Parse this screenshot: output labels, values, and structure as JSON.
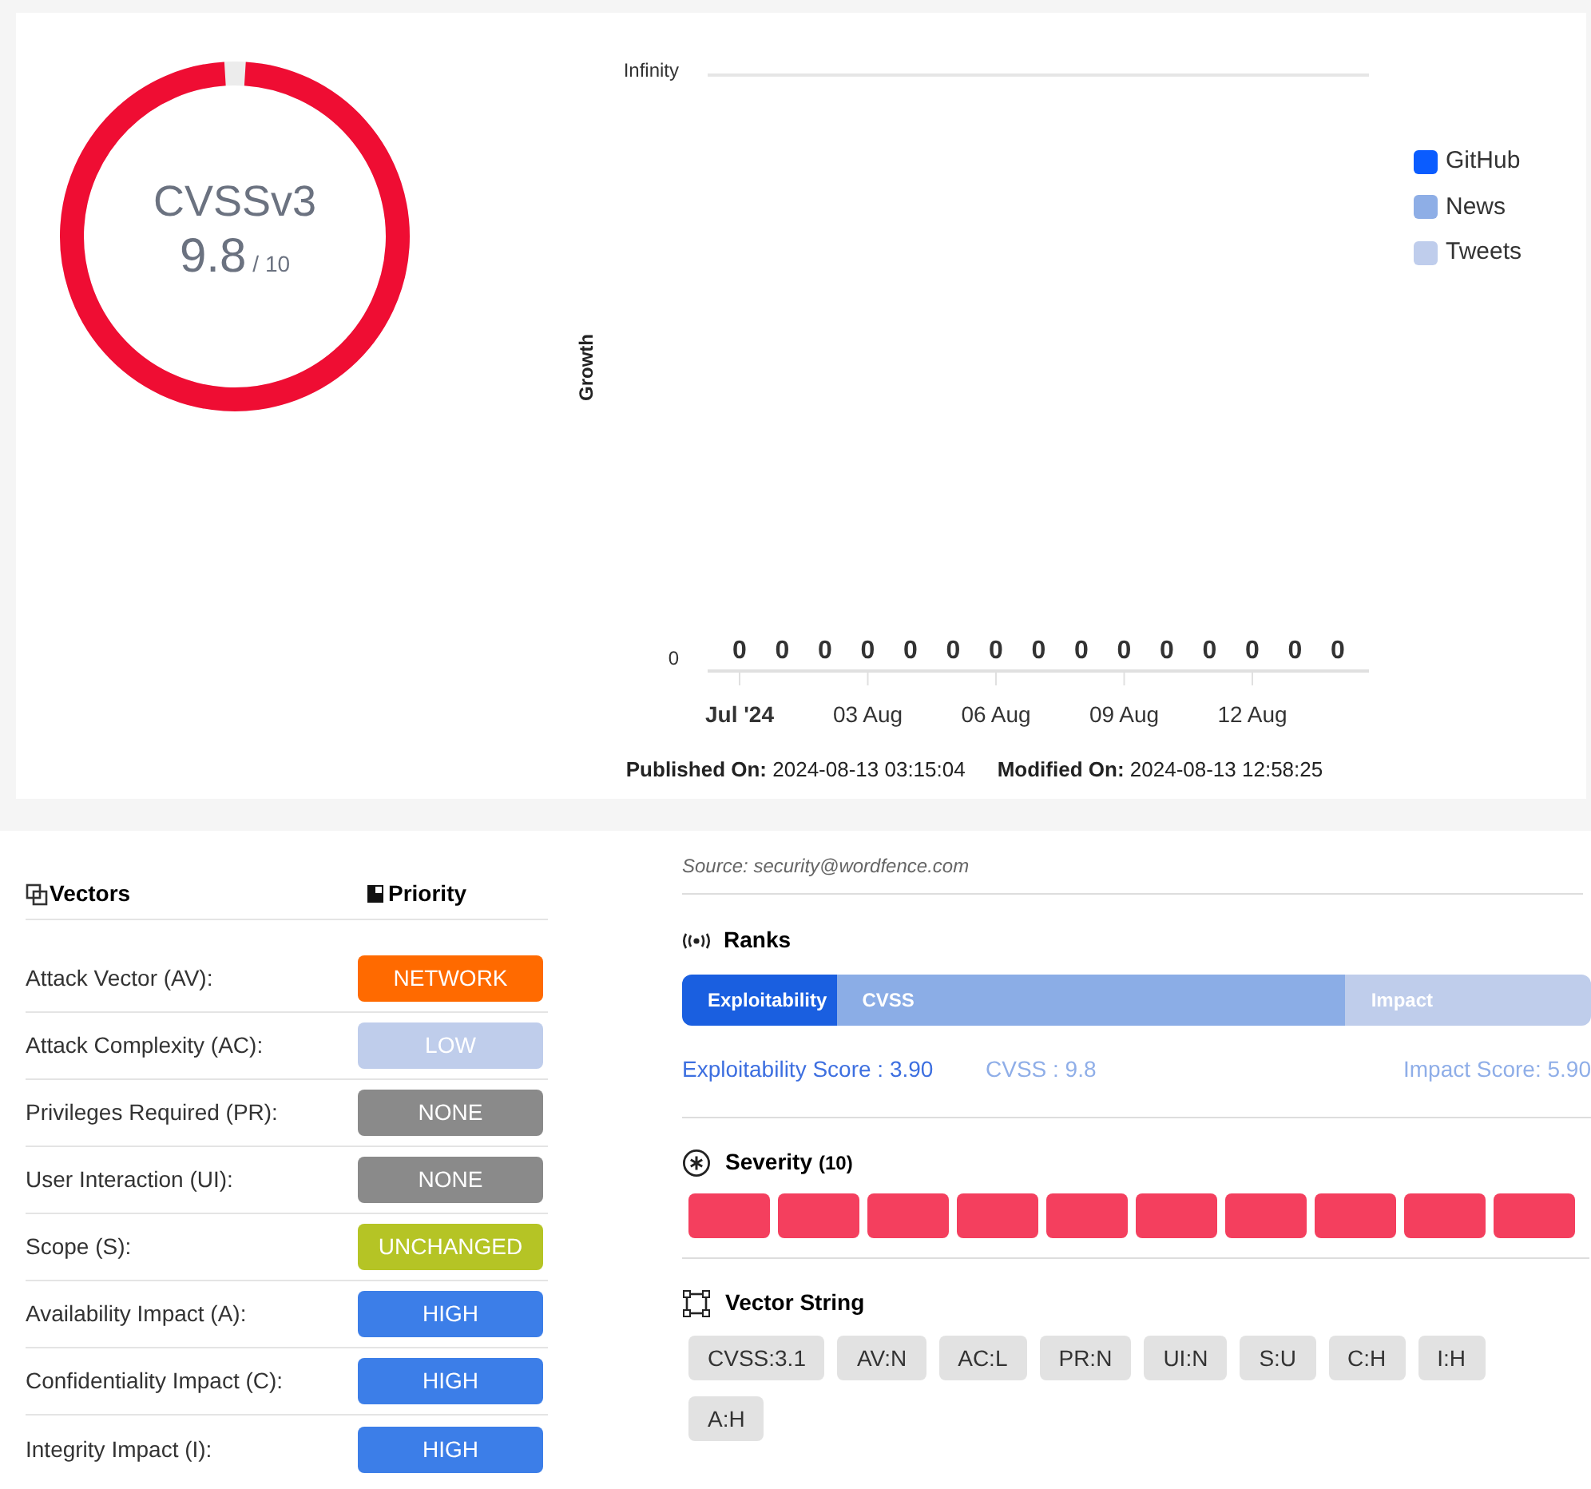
{
  "gauge": {
    "title": "CVSSv3",
    "score": "9.8",
    "max": "/ 10",
    "level": 0.98
  },
  "growth_chart": {
    "y_axis_title": "Growth",
    "y_axis_labels": [
      "Infinity",
      "0"
    ],
    "points": [
      {
        "value_label": "0",
        "x_label": "Jul '24"
      },
      {
        "value_label": "0"
      },
      {
        "value_label": "0"
      },
      {
        "value_label": "0",
        "x_label": "03 Aug"
      },
      {
        "value_label": "0"
      },
      {
        "value_label": "0"
      },
      {
        "value_label": "0",
        "x_label": "06 Aug"
      },
      {
        "value_label": "0"
      },
      {
        "value_label": "0"
      },
      {
        "value_label": "0",
        "x_label": "09 Aug"
      },
      {
        "value_label": "0"
      },
      {
        "value_label": "0"
      },
      {
        "value_label": "0",
        "x_label": "12 Aug"
      },
      {
        "value_label": "0"
      },
      {
        "value_label": "0"
      }
    ],
    "legend": [
      {
        "name": "GitHub",
        "color": "#0a5cff"
      },
      {
        "name": "News",
        "color": "#8eaee6"
      },
      {
        "name": "Tweets",
        "color": "#bfcdec"
      }
    ]
  },
  "dates": [
    "**Published On:** 2024-08-13 03:15:04",
    "**Modified On:** 2024-08-13 12:58:25"
  ],
  "vectors": {
    "heading": "Vectors",
    "priority_heading": "Priority",
    "rows": [
      {
        "label": "Attack Vector (AV):",
        "value": "NETWORK",
        "color": "#ff6a00"
      },
      {
        "label": "Attack Complexity (AC):",
        "value": "LOW",
        "color": "#bfcdeb"
      },
      {
        "label": "Privileges Required (PR):",
        "value": "NONE",
        "color": "#8a8a8a"
      },
      {
        "label": "User Interaction (UI):",
        "value": "NONE",
        "color": "#8a8a8a"
      },
      {
        "label": "Scope (S):",
        "value": "UNCHANGED",
        "color": "#b5c425"
      },
      {
        "label": "Availability Impact (A):",
        "value": "HIGH",
        "color": "#3c7ee8"
      },
      {
        "label": "Confidentiality Impact (C):",
        "value": "HIGH",
        "color": "#3c7ee8"
      },
      {
        "label": "Integrity Impact (I):",
        "value": "HIGH",
        "color": "#3c7ee8"
      }
    ]
  },
  "source": "Source: security@wordfence.com",
  "ranks": {
    "title": "Ranks",
    "segments": [
      {
        "label": "Exploitability",
        "color": "#1a5fe0"
      },
      {
        "label": "CVSS",
        "color": "#8badE6"
      },
      {
        "label": "Impact",
        "color": "#bfcdeb"
      }
    ],
    "scores": [
      {
        "text": "Exploitability Score : 3.90",
        "color": "#3d6fe0"
      },
      {
        "text": "CVSS : 9.8",
        "color": "#8faee8"
      },
      {
        "text": "Impact Score: 5.90",
        "color": "#8faee8"
      }
    ]
  },
  "severity": {
    "title": "Severity",
    "count": "(10)",
    "stars": 10
  },
  "vector_string": {
    "title": "Vector String",
    "tags": [
      "CVSS:3.1",
      "AV:N",
      "AC:L",
      "PR:N",
      "UI:N",
      "S:U",
      "C:H",
      "I:H",
      "A:H"
    ]
  }
}
